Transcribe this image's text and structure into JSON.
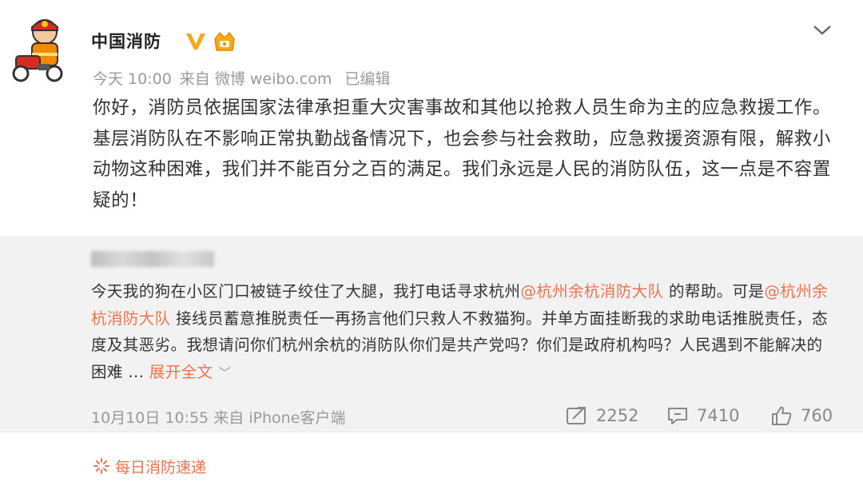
{
  "post": {
    "author_name": "中国消防",
    "timestamp": "今天 10:00",
    "source": "来自 微博 weibo.com",
    "edited": "已编辑",
    "body": "你好，消防员依据国家法律承担重大灾害事故和其他以抢救人员生命为主的应急救援工作。基层消防队在不影响正常执勤战备情况下，也会参与社会救助，应急救援资源有限，解救小动物这种困难，我们并不能百分之百的满足。我们永远是人民的消防队伍，这一点是不容置疑的！"
  },
  "quoted": {
    "text_1": "今天我的狗在小区门口被链子绞住了大腿，我打电话寻求杭州",
    "mention_1": "@杭州余杭消防大队",
    "text_2": " 的帮助。可是",
    "mention_2": "@杭州余杭消防大队",
    "text_3": " 接线员蓄意推脱责任一再扬言他们只救人不救猫狗。并单方面挂断我的求助电话推脱责任，态度及其恶劣。我想请问你们杭州余杭的消防队你们是共产党吗？你们是政府机构吗？人民遇到不能解决的困难 ... ",
    "expand_label": "展开全文",
    "expand_chevron": "﹀",
    "timestamp": "10月10日 10:55",
    "source": "来自 iPhone客户端",
    "reposts": "2252",
    "comments": "7410",
    "likes": "760"
  },
  "tag": {
    "label": "每日消防速递"
  },
  "colors": {
    "accent": "#eb7350",
    "verified": "#f7a81b",
    "quote_bg": "#f2f2f2",
    "meta_gray": "#9a9a9a"
  },
  "icons": [
    "firefighter-avatar",
    "verified-icon",
    "member-icon",
    "chevron-down-icon",
    "repost-icon",
    "comment-icon",
    "like-icon",
    "tag-icon"
  ]
}
